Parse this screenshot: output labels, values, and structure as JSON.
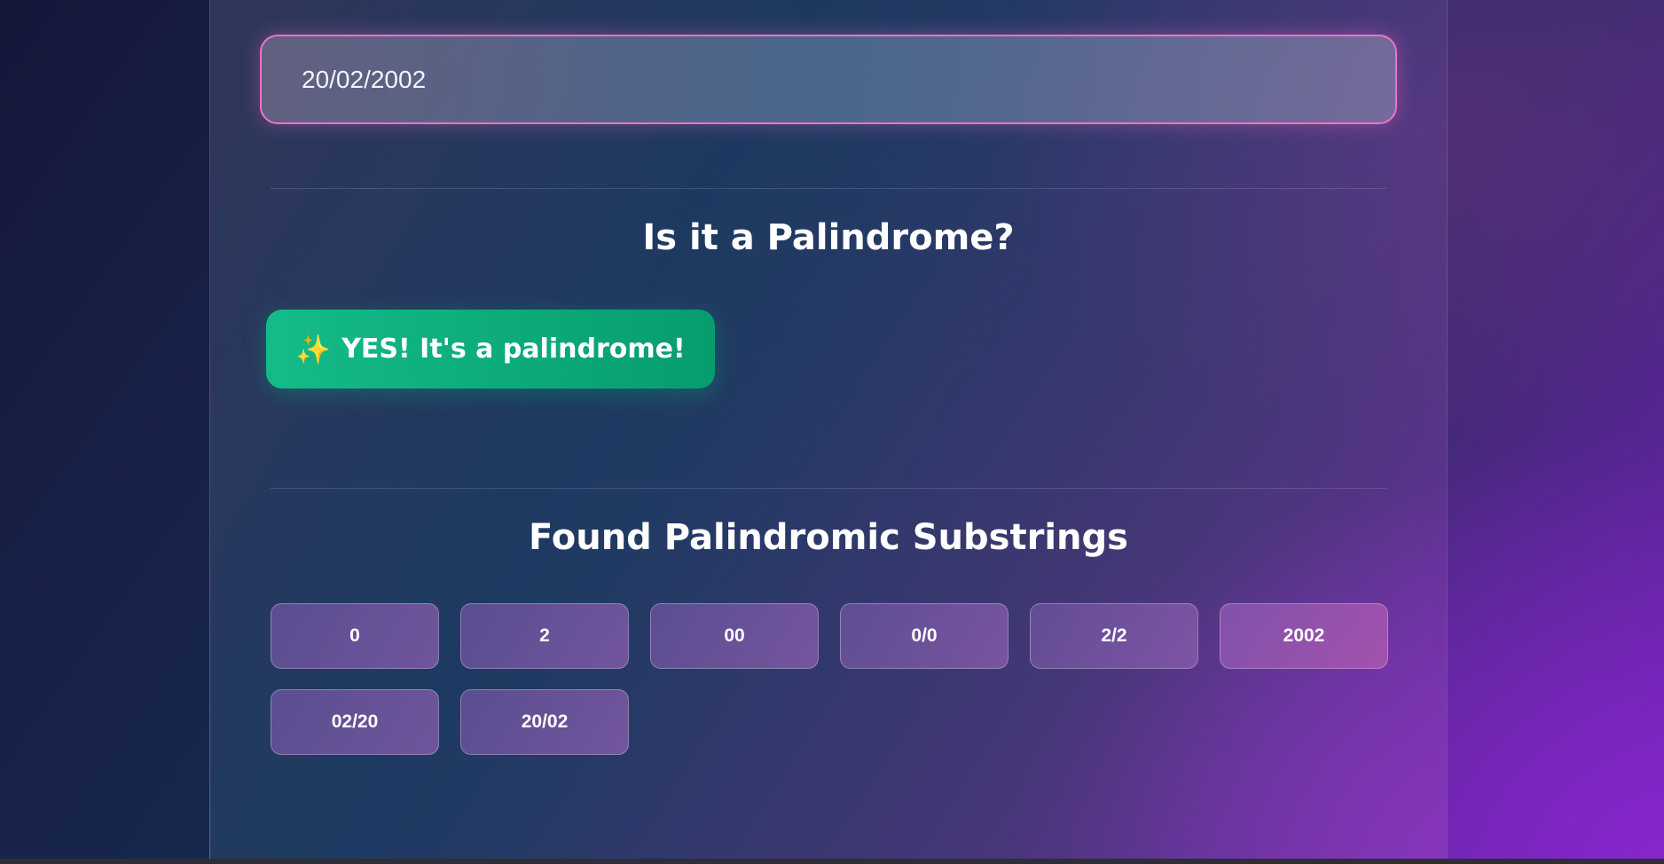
{
  "input": {
    "value": "20/02/2002"
  },
  "palindrome_check": {
    "title": "Is it a Palindrome?",
    "result_icon": "sparkle-icon",
    "result_icon_glyph": "✨",
    "result_text": "YES! It's a palindrome!",
    "result_color": "#10b07f"
  },
  "substrings": {
    "title": "Found Palindromic Substrings",
    "items": [
      "0",
      "2",
      "00",
      "0/0",
      "2/2",
      "2002",
      "02/20",
      "20/02"
    ]
  },
  "colors": {
    "input_border": "#f072c4",
    "success": "#10b07f"
  }
}
